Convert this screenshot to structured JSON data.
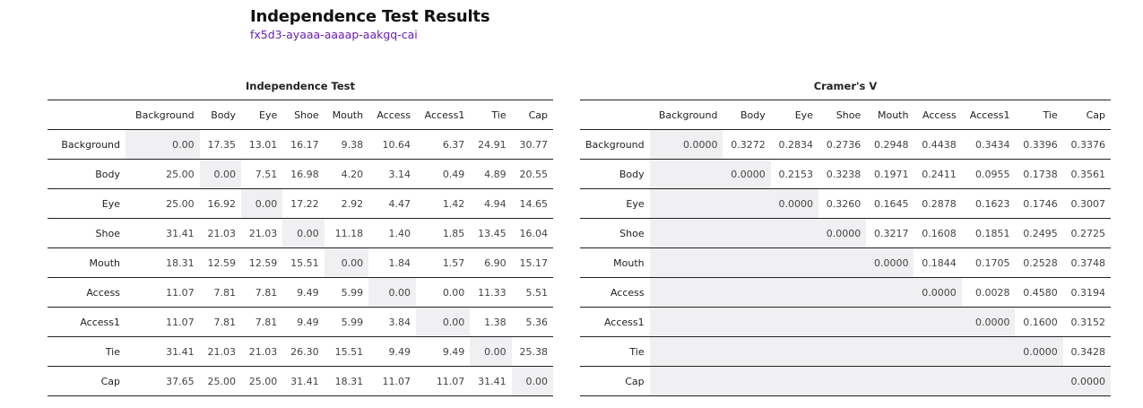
{
  "header": {
    "title": "Independence Test Results",
    "subtitle": "fx5d3-ayaaa-aaaap-aakgq-cai"
  },
  "tables": [
    {
      "title": "Independence Test",
      "columns": [
        "Background",
        "Body",
        "Eye",
        "Shoe",
        "Mouth",
        "Access",
        "Access1",
        "Tie",
        "Cap"
      ],
      "rows": [
        {
          "label": "Background",
          "values": [
            "0.00",
            "17.35",
            "13.01",
            "16.17",
            "9.38",
            "10.64",
            "6.37",
            "24.91",
            "30.77"
          ]
        },
        {
          "label": "Body",
          "values": [
            "25.00",
            "0.00",
            "7.51",
            "16.98",
            "4.20",
            "3.14",
            "0.49",
            "4.89",
            "20.55"
          ]
        },
        {
          "label": "Eye",
          "values": [
            "25.00",
            "16.92",
            "0.00",
            "17.22",
            "2.92",
            "4.47",
            "1.42",
            "4.94",
            "14.65"
          ]
        },
        {
          "label": "Shoe",
          "values": [
            "31.41",
            "21.03",
            "21.03",
            "0.00",
            "11.18",
            "1.40",
            "1.85",
            "13.45",
            "16.04"
          ]
        },
        {
          "label": "Mouth",
          "values": [
            "18.31",
            "12.59",
            "12.59",
            "15.51",
            "0.00",
            "1.84",
            "1.57",
            "6.90",
            "15.17"
          ]
        },
        {
          "label": "Access",
          "values": [
            "11.07",
            "7.81",
            "7.81",
            "9.49",
            "5.99",
            "0.00",
            "0.00",
            "11.33",
            "5.51"
          ]
        },
        {
          "label": "Access1",
          "values": [
            "11.07",
            "7.81",
            "7.81",
            "9.49",
            "5.99",
            "3.84",
            "0.00",
            "1.38",
            "5.36"
          ]
        },
        {
          "label": "Tie",
          "values": [
            "31.41",
            "21.03",
            "21.03",
            "26.30",
            "15.51",
            "9.49",
            "9.49",
            "0.00",
            "25.38"
          ]
        },
        {
          "label": "Cap",
          "values": [
            "37.65",
            "25.00",
            "25.00",
            "31.41",
            "18.31",
            "11.07",
            "11.07",
            "31.41",
            "0.00"
          ]
        }
      ]
    },
    {
      "title": "Cramer's V",
      "columns": [
        "Background",
        "Body",
        "Eye",
        "Shoe",
        "Mouth",
        "Access",
        "Access1",
        "Tie",
        "Cap"
      ],
      "rows": [
        {
          "label": "Background",
          "values": [
            "0.0000",
            "0.3272",
            "0.2834",
            "0.2736",
            "0.2948",
            "0.4438",
            "0.3434",
            "0.3396",
            "0.3376"
          ]
        },
        {
          "label": "Body",
          "values": [
            "",
            "0.0000",
            "0.2153",
            "0.3238",
            "0.1971",
            "0.2411",
            "0.0955",
            "0.1738",
            "0.3561"
          ]
        },
        {
          "label": "Eye",
          "values": [
            "",
            "",
            "0.0000",
            "0.3260",
            "0.1645",
            "0.2878",
            "0.1623",
            "0.1746",
            "0.3007"
          ]
        },
        {
          "label": "Shoe",
          "values": [
            "",
            "",
            "",
            "0.0000",
            "0.3217",
            "0.1608",
            "0.1851",
            "0.2495",
            "0.2725"
          ]
        },
        {
          "label": "Mouth",
          "values": [
            "",
            "",
            "",
            "",
            "0.0000",
            "0.1844",
            "0.1705",
            "0.2528",
            "0.3748"
          ]
        },
        {
          "label": "Access",
          "values": [
            "",
            "",
            "",
            "",
            "",
            "0.0000",
            "0.0028",
            "0.4580",
            "0.3194"
          ]
        },
        {
          "label": "Access1",
          "values": [
            "",
            "",
            "",
            "",
            "",
            "",
            "0.0000",
            "0.1600",
            "0.3152"
          ]
        },
        {
          "label": "Tie",
          "values": [
            "",
            "",
            "",
            "",
            "",
            "",
            "",
            "0.0000",
            "0.3428"
          ]
        },
        {
          "label": "Cap",
          "values": [
            "",
            "",
            "",
            "",
            "",
            "",
            "",
            "",
            "0.0000"
          ]
        }
      ]
    }
  ]
}
